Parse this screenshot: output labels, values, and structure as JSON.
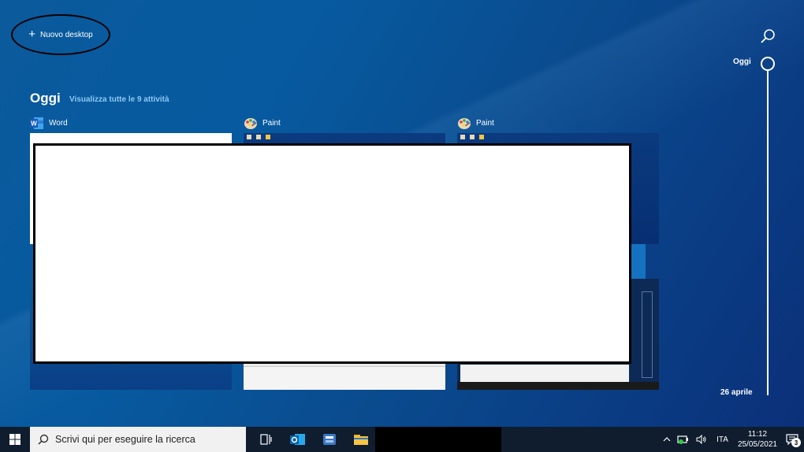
{
  "new_desktop": {
    "label": "Nuovo desktop"
  },
  "search_icon": "search-icon",
  "timeline": {
    "top_label": "Oggi",
    "bottom_label": "26 aprile"
  },
  "section": {
    "title": "Oggi",
    "link": "Visualizza tutte le 9 attività"
  },
  "cards": [
    {
      "app": "Word",
      "icon": "word-icon"
    },
    {
      "app": "Paint",
      "icon": "paint-icon"
    },
    {
      "app": "Paint",
      "icon": "paint-icon"
    }
  ],
  "taskbar": {
    "search_placeholder": "Scrivi qui per eseguire la ricerca",
    "language": "ITA",
    "time": "11:12",
    "date": "25/05/2021",
    "notification_count": "3"
  },
  "colors": {
    "accent_link": "#8cc8f2",
    "taskbar": "#0f1d2f"
  }
}
